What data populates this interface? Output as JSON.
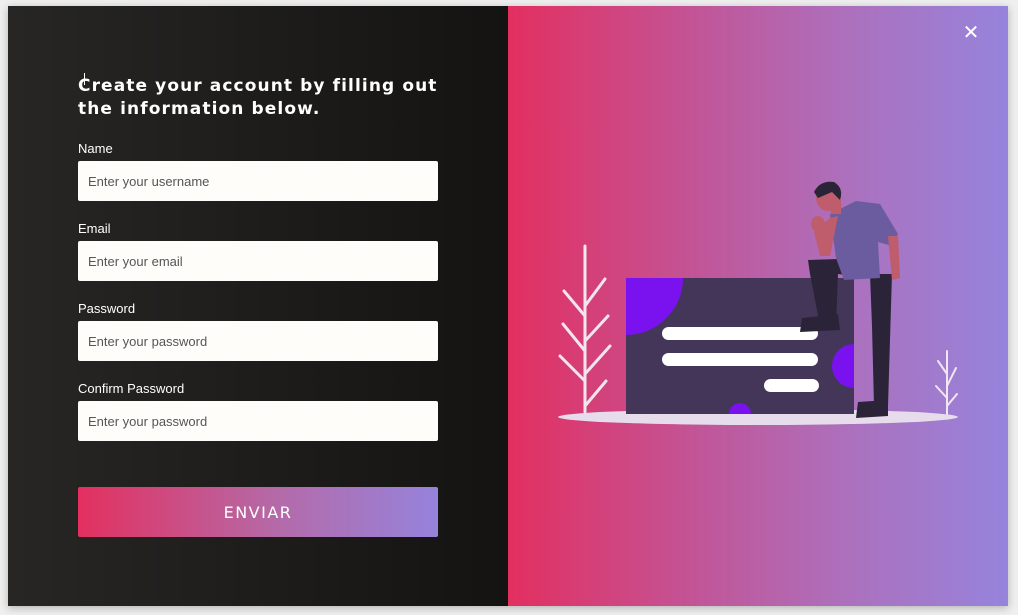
{
  "form": {
    "title": "Create your account by filling out the information below.",
    "fields": [
      {
        "label": "Name",
        "placeholder": "Enter your username",
        "value": ""
      },
      {
        "label": "Email",
        "placeholder": "Enter your email",
        "value": ""
      },
      {
        "label": "Password",
        "placeholder": "Enter your password",
        "value": ""
      },
      {
        "label": "Confirm Password",
        "placeholder": "Enter your password",
        "value": ""
      }
    ],
    "submit_label": "ENVIAR"
  },
  "close_label": "✕",
  "colors": {
    "gradient_start": "#e3305f",
    "gradient_end": "#9683dc",
    "panel_dark": "#1b1a19",
    "illustration_accent": "#7a12f0"
  }
}
